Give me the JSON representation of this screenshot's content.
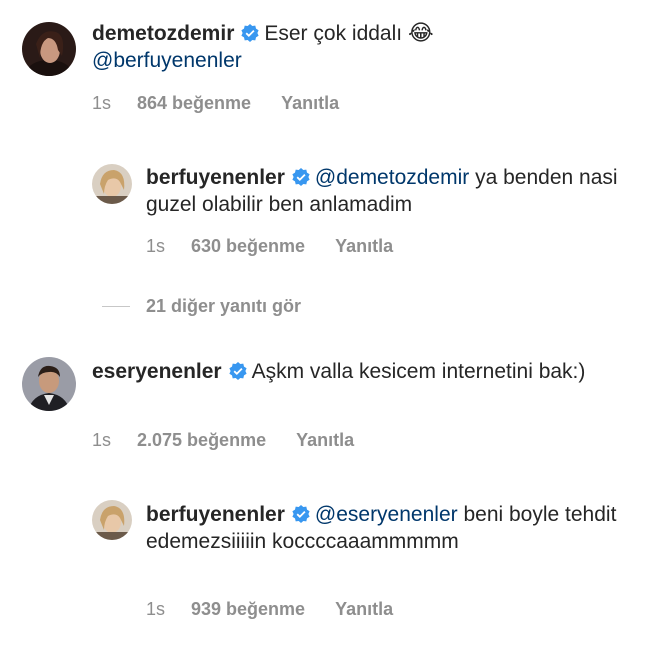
{
  "comments": [
    {
      "username": "demetozdemir",
      "text_before": "Eser çok iddalı ",
      "emoji": "😂",
      "mention_after": "@berfuyenenler",
      "time": "1s",
      "likes": "864 beğenme",
      "reply": "Yanıtla"
    },
    {
      "username": "berfuyenenler",
      "mention": "@demetozdemir",
      "text": " ya benden nasi guzel olabilir ben anlamadim",
      "time": "1s",
      "likes": "630 beğenme",
      "reply": "Yanıtla"
    },
    {
      "username": "eseryenenler",
      "text": "Aşkm valla kesicem internetini bak:)",
      "time": "1s",
      "likes": "2.075 beğenme",
      "reply": "Yanıtla"
    },
    {
      "username": "berfuyenenler",
      "mention": "@eseryenenler",
      "text": " beni boyle tehdit edemezsiiiiin koccccaaammmmm",
      "time": "1s",
      "likes": "939 beğenme",
      "reply": "Yanıtla"
    }
  ],
  "view_more_replies": "21 diğer yanıtı gör",
  "colors": {
    "mention": "#00376b",
    "meta": "#8e8e8e",
    "verified": "#3897f0"
  },
  "icons": {
    "verified": "verified-badge-icon"
  }
}
